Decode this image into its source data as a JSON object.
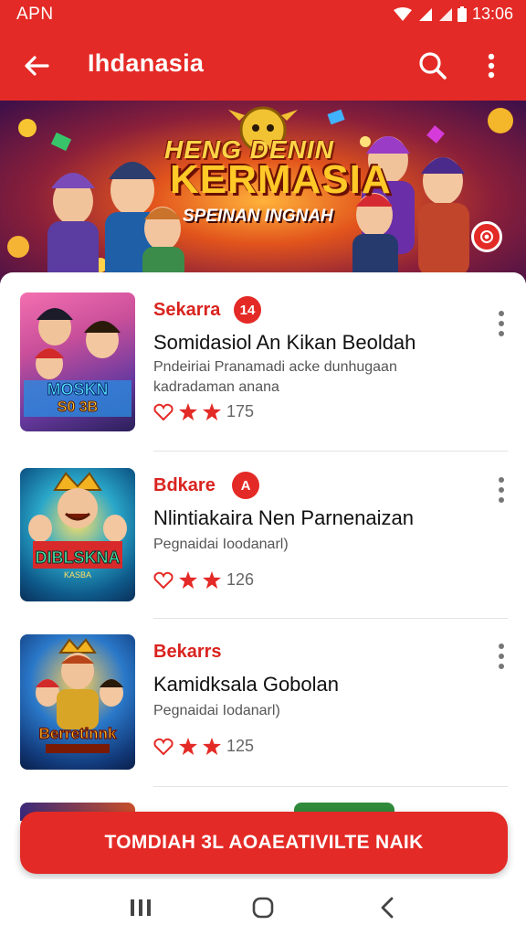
{
  "status_bar": {
    "left_text": "APN",
    "time": "13:06"
  },
  "app_bar": {
    "title": "Ihdanasia",
    "back_icon": "arrow-left-icon",
    "search_icon": "search-icon",
    "more_icon": "more-vert-icon"
  },
  "banner": {
    "line1": "HENG DENIN",
    "line2": "KERMASIA",
    "line3": "SPEINAN INGNAH"
  },
  "colors": {
    "primary": "#e42a26",
    "accent_text": "#d9231f",
    "star": "#e42a26"
  },
  "items": [
    {
      "publisher": "Sekarra",
      "badge": "14",
      "title": "Somidasiol An Kikan Beoldah",
      "desc": "Pndeiriai Pranamadi acke dunhugaan kadradaman anana",
      "rating_count": "175"
    },
    {
      "publisher": "Bdkare",
      "badge": "A",
      "title": "Nlintiakaira Nen Parnenaizan",
      "desc": "Pegnaidai Ioodanarl)",
      "rating_count": "126"
    },
    {
      "publisher": "Bekarrs",
      "badge": "",
      "title": "Kamidksala Gobolan",
      "desc": "Pegnaidai Iodanarl)",
      "rating_count": "125"
    }
  ],
  "cta": {
    "label": "TOMDIAH 3L AOAEATIVILTE NAIK"
  }
}
